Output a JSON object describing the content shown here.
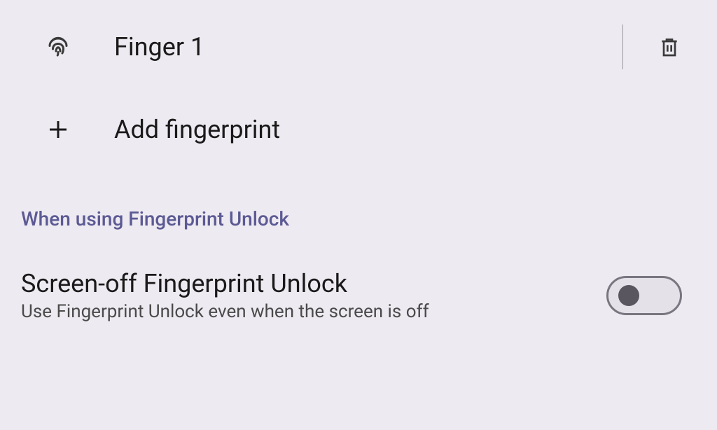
{
  "fingerprints": [
    {
      "label": "Finger 1"
    }
  ],
  "addLabel": "Add fingerprint",
  "sectionHeader": "When using Fingerprint Unlock",
  "setting": {
    "title": "Screen-off Fingerprint Unlock",
    "subtitle": "Use Fingerprint Unlock even when the screen is off",
    "enabled": false
  }
}
